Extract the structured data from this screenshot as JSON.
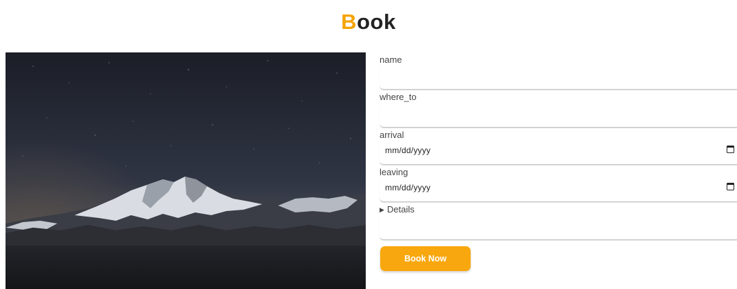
{
  "heading": {
    "first_letter": "B",
    "rest": "ook"
  },
  "hero_image": {
    "description": "snowy-mountain-night-sky"
  },
  "form": {
    "name": {
      "label": "name",
      "value": ""
    },
    "where_to": {
      "label": "where_to",
      "value": ""
    },
    "arrival": {
      "label": "arrival",
      "placeholder": "mm/dd/yyyy"
    },
    "leaving": {
      "label": "leaving",
      "placeholder": "mm/dd/yyyy"
    },
    "details": {
      "label": "Details",
      "marker": "▶"
    },
    "submit_label": "Book Now"
  },
  "colors": {
    "accent": "#f9a70f",
    "heading_accent": "#f5a300",
    "heading_text": "#222222"
  }
}
